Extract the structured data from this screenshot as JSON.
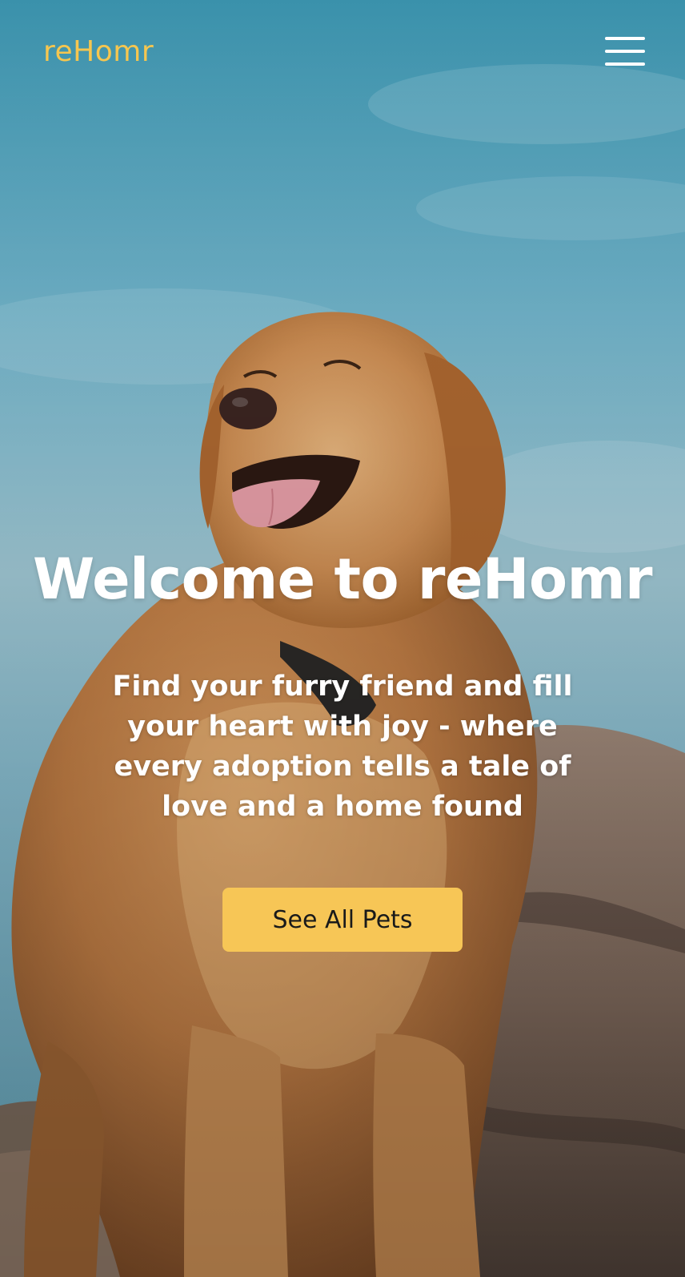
{
  "header": {
    "logo_text": "reHomr",
    "menu_icon": "hamburger-menu-icon"
  },
  "hero": {
    "title": "Welcome to reHomr",
    "subtitle": "Find your furry friend and fill your heart with joy - where every adoption tells a tale of love and a home found",
    "cta_label": "See All Pets",
    "background_image": "golden-retriever-on-rock-photo"
  },
  "colors": {
    "accent": "#f7c656",
    "logo": "#f6c64f",
    "text": "#ffffff",
    "button_text": "#1a1a1a"
  }
}
